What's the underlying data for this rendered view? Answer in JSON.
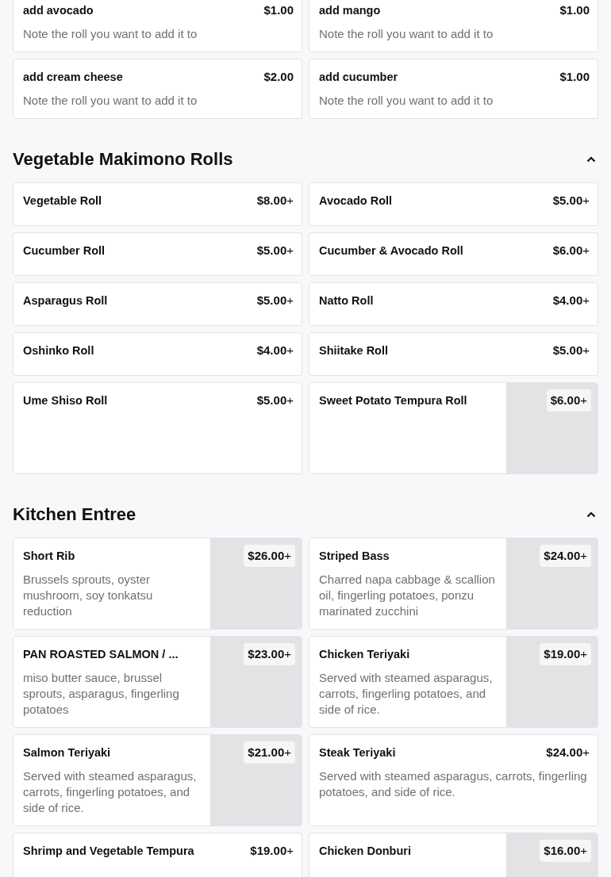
{
  "sections": [
    {
      "items": [
        {
          "name": "add avocado",
          "price": "**$1.00**",
          "description": "Note the roll you want to add it to",
          "has_image": false
        },
        {
          "name": "add mango",
          "price": "**$1.00**",
          "description": "Note the roll you want to add it to",
          "has_image": false
        },
        {
          "name": "add cream cheese",
          "price": "**$2.00**",
          "description": "Note the roll you want to add it to",
          "has_image": false
        },
        {
          "name": "add cucumber",
          "price": "**$1.00**",
          "description": "Note the roll you want to add it to",
          "has_image": false
        }
      ]
    },
    {
      "title": "Vegetable Makimono Rolls",
      "expanded": true,
      "items": [
        {
          "name": "Vegetable Roll",
          "price": "**$8.00**+",
          "has_image": false
        },
        {
          "name": "Avocado Roll",
          "price": "**$5.00**+",
          "has_image": false
        },
        {
          "name": "Cucumber Roll",
          "price": "**$5.00**+",
          "has_image": false
        },
        {
          "name": "Cucumber & Avocado Roll",
          "price": "**$6.00**+",
          "has_image": false
        },
        {
          "name": "Asparagus Roll",
          "price": "**$5.00**+",
          "has_image": false
        },
        {
          "name": "Natto Roll",
          "price": "**$4.00**+",
          "has_image": false
        },
        {
          "name": "Oshinko Roll",
          "price": "**$4.00**+",
          "has_image": false
        },
        {
          "name": "Shiitake Roll",
          "price": "**$5.00**+",
          "has_image": false
        },
        {
          "name": "Ume Shiso Roll",
          "price": "**$5.00**+",
          "has_image": false
        },
        {
          "name": "Sweet Potato Tempura Roll",
          "price": "**$6.00**+",
          "has_image": true
        }
      ]
    },
    {
      "title": "Kitchen Entree",
      "expanded": true,
      "items": [
        {
          "name": "Short Rib",
          "price": "**$26.00**+",
          "description": "Brussels sprouts, oyster mushroom, soy tonkatsu reduction",
          "has_image": true
        },
        {
          "name": "Striped Bass",
          "price": "**$24.00**+",
          "description": "Charred napa cabbage & scallion oil, fingerling potatoes, ponzu marinated zucchini",
          "has_image": true
        },
        {
          "name": "PAN ROASTED SALMON / ...",
          "price": "**$23.00**+",
          "description": "miso butter sauce, brussel sprouts, asparagus, fingerling potatoes",
          "has_image": true
        },
        {
          "name": "Chicken Teriyaki",
          "price": "**$19.00**+",
          "description": "Served with steamed asparagus, carrots, fingerling potatoes, and side of rice.",
          "has_image": true
        },
        {
          "name": "Salmon Teriyaki",
          "price": "**$21.00**+",
          "description": "Served with steamed asparagus, carrots, fingerling potatoes, and side of rice.",
          "has_image": true
        },
        {
          "name": "Steak Teriyaki",
          "price": "**$24.00**+",
          "description": "Served with steamed asparagus, carrots, fingerling potatoes, and side of rice.",
          "has_image": false
        },
        {
          "name": "Shrimp and Vegetable Tempura",
          "price": "**$19.00**+",
          "has_image": false
        },
        {
          "name": "Chicken Donburi",
          "price": "**$16.00**+",
          "has_image": true
        }
      ]
    }
  ]
}
